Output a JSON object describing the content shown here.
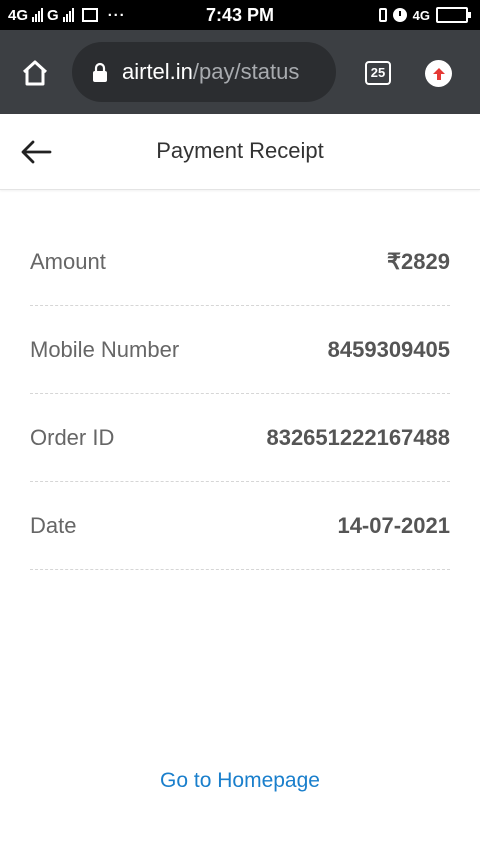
{
  "status_bar": {
    "network1": "4G",
    "network2": "G",
    "time": "7:43 PM",
    "right_network": "4G"
  },
  "browser": {
    "url_host": "airtel.in",
    "url_path": "/pay/status",
    "tab_count": "25"
  },
  "header": {
    "title": "Payment Receipt"
  },
  "receipt": {
    "rows": [
      {
        "label": "Amount",
        "value": "₹2829"
      },
      {
        "label": "Mobile Number",
        "value": "8459309405"
      },
      {
        "label": "Order ID",
        "value": "832651222167488"
      },
      {
        "label": "Date",
        "value": "14-07-2021"
      }
    ]
  },
  "footer": {
    "home_link": "Go to Homepage"
  },
  "colors": {
    "link": "#1a7fcc",
    "browser_bar": "#3c3f43",
    "extension_accent": "#e53935"
  }
}
